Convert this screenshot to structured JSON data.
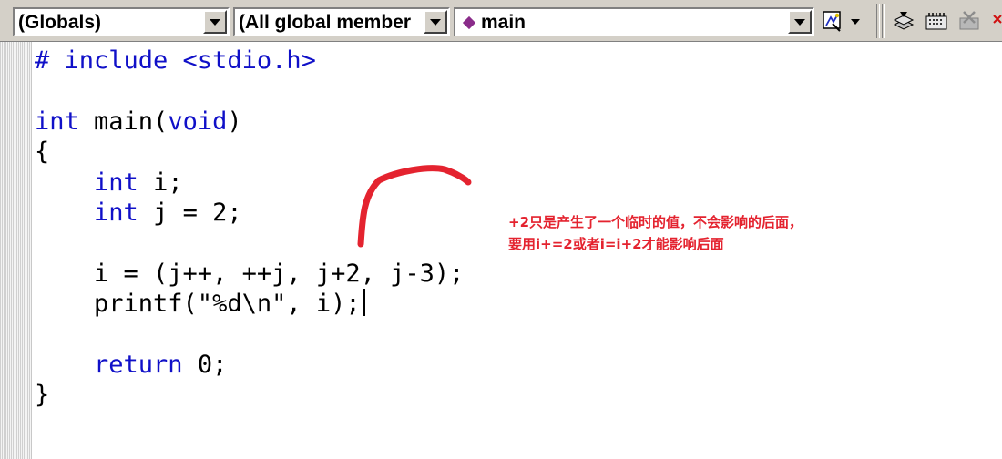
{
  "toolbar": {
    "scope_combo": "(Globals)",
    "members_combo": "(All global member",
    "function_combo": "main",
    "icons": [
      "wizard-bar-icon",
      "dropdown-arrow-icon",
      "compile-icon",
      "build-icon",
      "stop-build-icon"
    ]
  },
  "editor": {
    "lines": [
      [
        {
          "t": "# include <stdio.h>",
          "c": "kw"
        }
      ],
      [],
      [
        {
          "t": "int",
          "c": "kw"
        },
        {
          "t": " main("
        },
        {
          "t": "void",
          "c": "kw"
        },
        {
          "t": ")"
        }
      ],
      [
        {
          "t": "{"
        }
      ],
      [
        {
          "t": "    "
        },
        {
          "t": "int",
          "c": "kw"
        },
        {
          "t": " i;"
        }
      ],
      [
        {
          "t": "    "
        },
        {
          "t": "int",
          "c": "kw"
        },
        {
          "t": " j = 2;"
        }
      ],
      [],
      [
        {
          "t": "    i = (j++, ++j, j+2, j-3);"
        }
      ],
      [
        {
          "t": "    printf(\"%d\\n\", i);"
        }
      ],
      [],
      [
        {
          "t": "    "
        },
        {
          "t": "return",
          "c": "kw"
        },
        {
          "t": " 0;"
        }
      ],
      [
        {
          "t": "}"
        }
      ]
    ],
    "caret_line": 8
  },
  "annotation": {
    "line1": "+2只是产生了一个临时的值，不会影响的后面，",
    "line2": "要用i+=2或者i=i+2才能影响后面",
    "color": "#e4232f"
  },
  "colors": {
    "keyword": "#1010c8",
    "toolbar_bg": "#d4d0c8",
    "function_icon": "#8a2c8a"
  }
}
